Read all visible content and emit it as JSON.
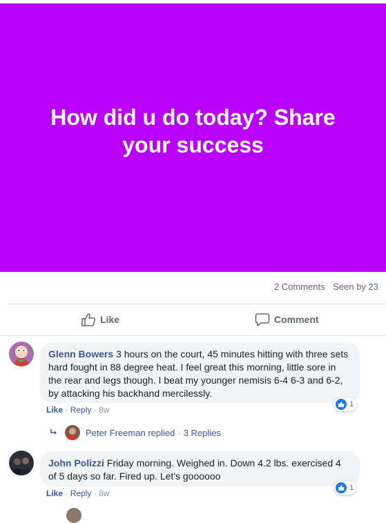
{
  "post": {
    "banner_text": "How did u do today? Share your success",
    "banner_color": "#b900fb"
  },
  "stats": {
    "comments": "2 Comments",
    "seen": "Seen by 23"
  },
  "actions": {
    "like": "Like",
    "comment": "Comment"
  },
  "comments": [
    {
      "author": "Glenn Bowers",
      "text": "3 hours on the court, 45 minutes hitting with three sets hard fought in 88 degree heat. I feel great this morning, little sore in the rear and legs though. I beat my younger nemisis 6-4 6-3 and 6-2, by attacking his backhand mercilessly.",
      "reaction_count": "1",
      "like": "Like",
      "reply": "Reply",
      "time": "8w",
      "sep": "·",
      "replies_preview": {
        "text": "Peter Freeman replied",
        "sep": "·",
        "count": "3 Replies"
      }
    },
    {
      "author": "John Polizzi",
      "text": "Friday morning. Weighed in. Down 4.2 lbs. exercised 4 of 5 days so far. Fired up. Let's goooooo",
      "reaction_count": "1",
      "like": "Like",
      "reply": "Reply",
      "time": "8w",
      "sep": "·"
    }
  ]
}
